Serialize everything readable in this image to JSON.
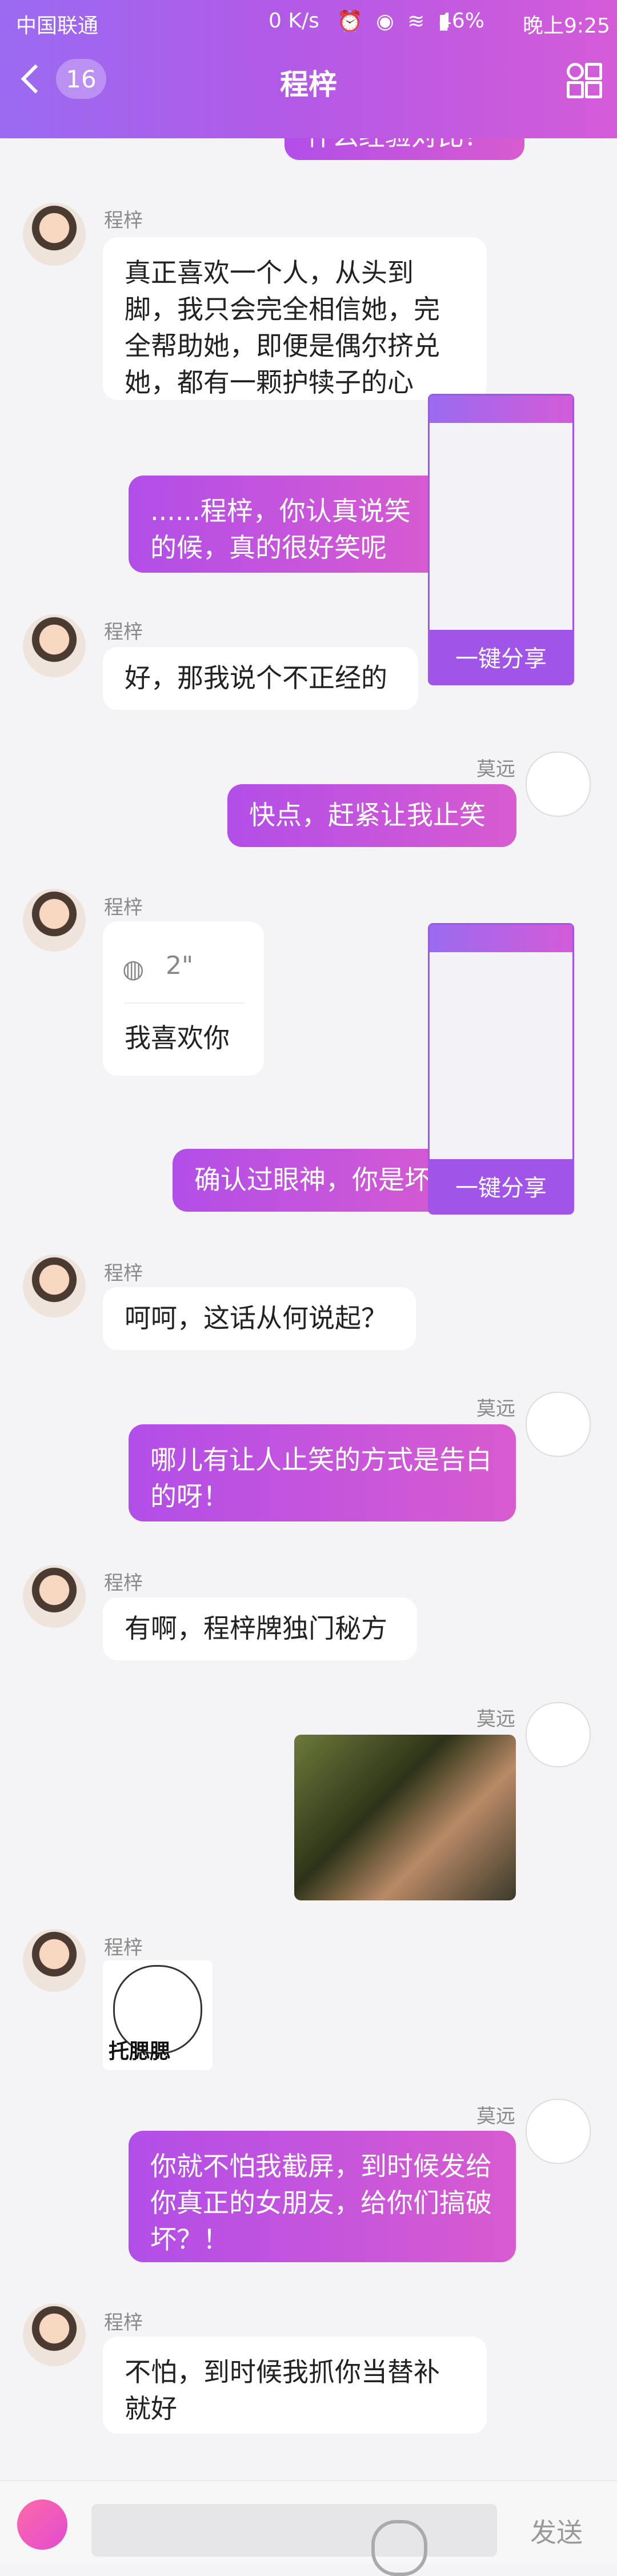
{
  "status": {
    "carrier": "中国联通",
    "speed": "0 K/s",
    "battery": "46%",
    "time": "晚上9:25"
  },
  "header": {
    "badge": "16",
    "title": "程梓"
  },
  "messages": {
    "m0_text": "什么经验对比？",
    "m1_name": "程梓",
    "m1_text": "真正喜欢一个人，从头到脚，我只会完全相信她，完全帮助她，即便是偶尔挤兑她，都有一颗护犊子的心",
    "m2_text": "......程梓，你认真说笑的候，真的很好笑呢",
    "m3_name": "程梓",
    "m3_text": "好，那我说个不正经的",
    "m4_name": "莫远",
    "m4_text": "快点，赶紧让我止笑",
    "m5_name": "程梓",
    "m5_voice_duration": "2\"",
    "m5_voice_text": "我喜欢你",
    "m6_text": "确认过眼神，你是坏",
    "m7_name": "程梓",
    "m7_text": "呵呵，这话从何说起？",
    "m8_name": "莫远",
    "m8_text": "哪儿有让人止笑的方式是告白的呀！",
    "m9_name": "程梓",
    "m9_text": "有啊，程梓牌独门秘方",
    "m10_name": "莫远",
    "m11_name": "程梓",
    "m11_sticker_label": "托腮腮",
    "m12_name": "莫远",
    "m12_text": "你就不怕我截屏，到时候发给你真正的女朋友，给你们搞破坏？！",
    "m13_name": "程梓",
    "m13_text": "不怕，到时候我抓你当替补就好"
  },
  "share": {
    "label": "一键分享"
  },
  "input": {
    "send_label": "发送"
  },
  "colors": {
    "accent": "#a055e8",
    "bubble_right": "#c453e0"
  }
}
